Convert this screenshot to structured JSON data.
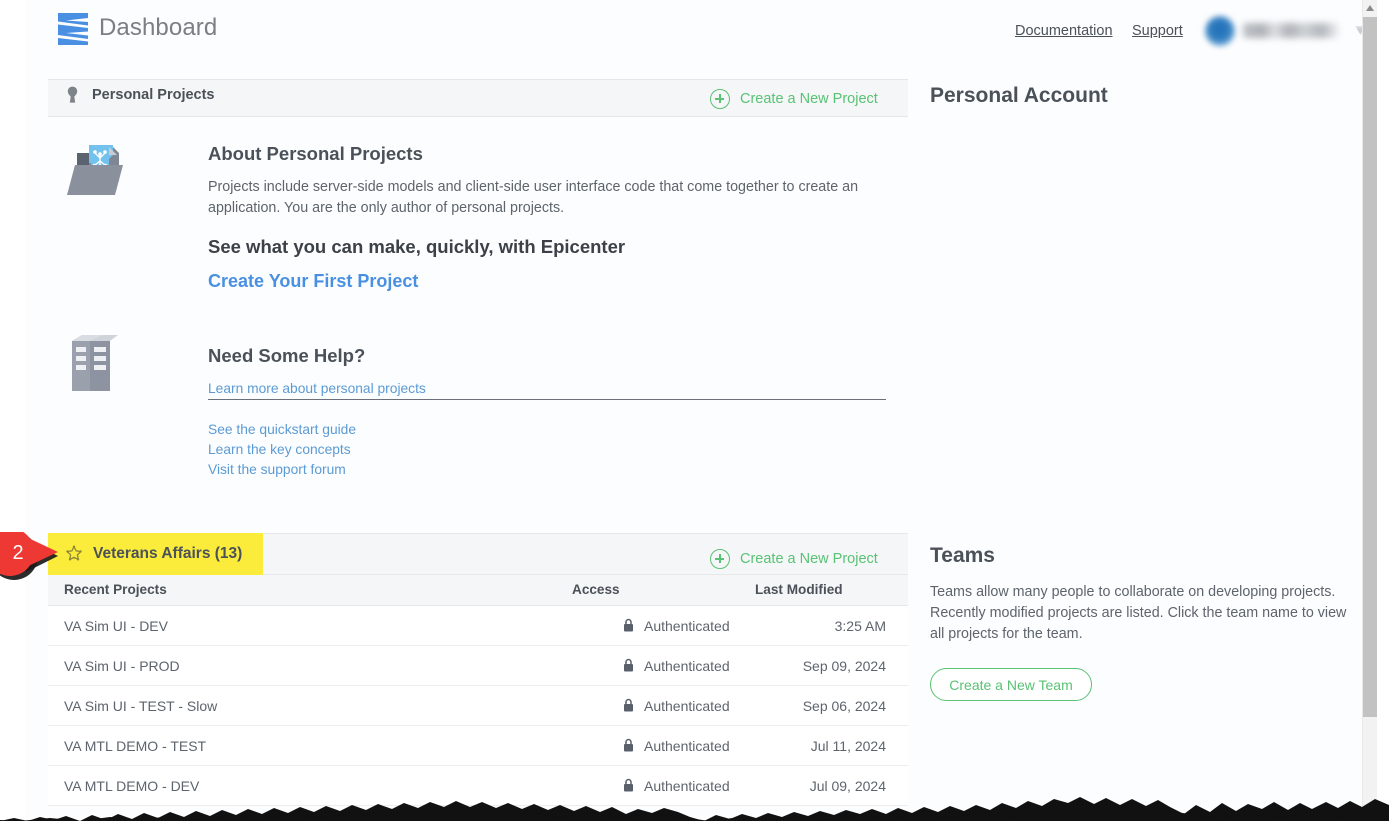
{
  "header": {
    "app_title": "Dashboard",
    "logo_icon": "epicenter-logo-icon",
    "links": [
      {
        "label": "Documentation",
        "name": "documentation-link"
      },
      {
        "label": "Support",
        "name": "support-link"
      }
    ],
    "user_menu": {
      "label": "",
      "redacted": true,
      "caret_icon": "chevron-down-icon"
    }
  },
  "personal_section": {
    "title": "Personal Projects",
    "icon": "user-head-icon",
    "create_label": "Create a New Project",
    "create_icon": "plus-circle-icon"
  },
  "about": {
    "heading": "About Personal Projects",
    "body": "Projects include server-side models and client-side user interface code that come together to create an application. You are the only author of personal projects.",
    "subheading": "See what you can make, quickly, with Epicenter",
    "cta_label": "Create Your First Project",
    "icon": "folder-document-icon"
  },
  "help": {
    "heading": "Need Some Help?",
    "icon": "books-icon",
    "primary_link": "Learn more about personal projects",
    "links": [
      "See the quickstart guide",
      "Learn the key concepts",
      "Visit the support forum"
    ]
  },
  "team_section": {
    "title": "Veterans Affairs (13)",
    "icon": "star-icon",
    "highlighted": true,
    "create_label": "Create a New Project",
    "create_icon": "plus-circle-icon",
    "marker": {
      "number": "2",
      "color": "#ee3833"
    }
  },
  "projects_table": {
    "columns": [
      "Recent Projects",
      "Access",
      "Last Modified"
    ],
    "rows": [
      {
        "name": "VA Sim UI - DEV",
        "access": "Authenticated",
        "access_icon": "lock-icon",
        "modified": "3:25 AM"
      },
      {
        "name": "VA Sim UI - PROD",
        "access": "Authenticated",
        "access_icon": "lock-icon",
        "modified": "Sep 09, 2024"
      },
      {
        "name": "VA Sim UI - TEST - Slow",
        "access": "Authenticated",
        "access_icon": "lock-icon",
        "modified": "Sep 06, 2024"
      },
      {
        "name": "VA MTL DEMO - TEST",
        "access": "Authenticated",
        "access_icon": "lock-icon",
        "modified": "Jul 11, 2024"
      },
      {
        "name": "VA MTL DEMO - DEV",
        "access": "Authenticated",
        "access_icon": "lock-icon",
        "modified": "Jul 09, 2024"
      }
    ]
  },
  "sidebar": {
    "account_heading": "Personal Account",
    "teams_heading": "Teams",
    "teams_body": "Teams allow many people to collaborate on developing projects. Recently modified projects are listed. Click the team name to view all projects for the team.",
    "create_team_label": "Create a New Team"
  },
  "colors": {
    "accent_green": "#59c274",
    "link_blue": "#5b9bd5",
    "cta_blue": "#4a90e2",
    "highlight_yellow": "#fbec3c",
    "marker_red": "#ee3833",
    "text_gray": "#5e646c",
    "heading_gray": "#4b5159",
    "panel_gray": "#f5f6f7"
  }
}
